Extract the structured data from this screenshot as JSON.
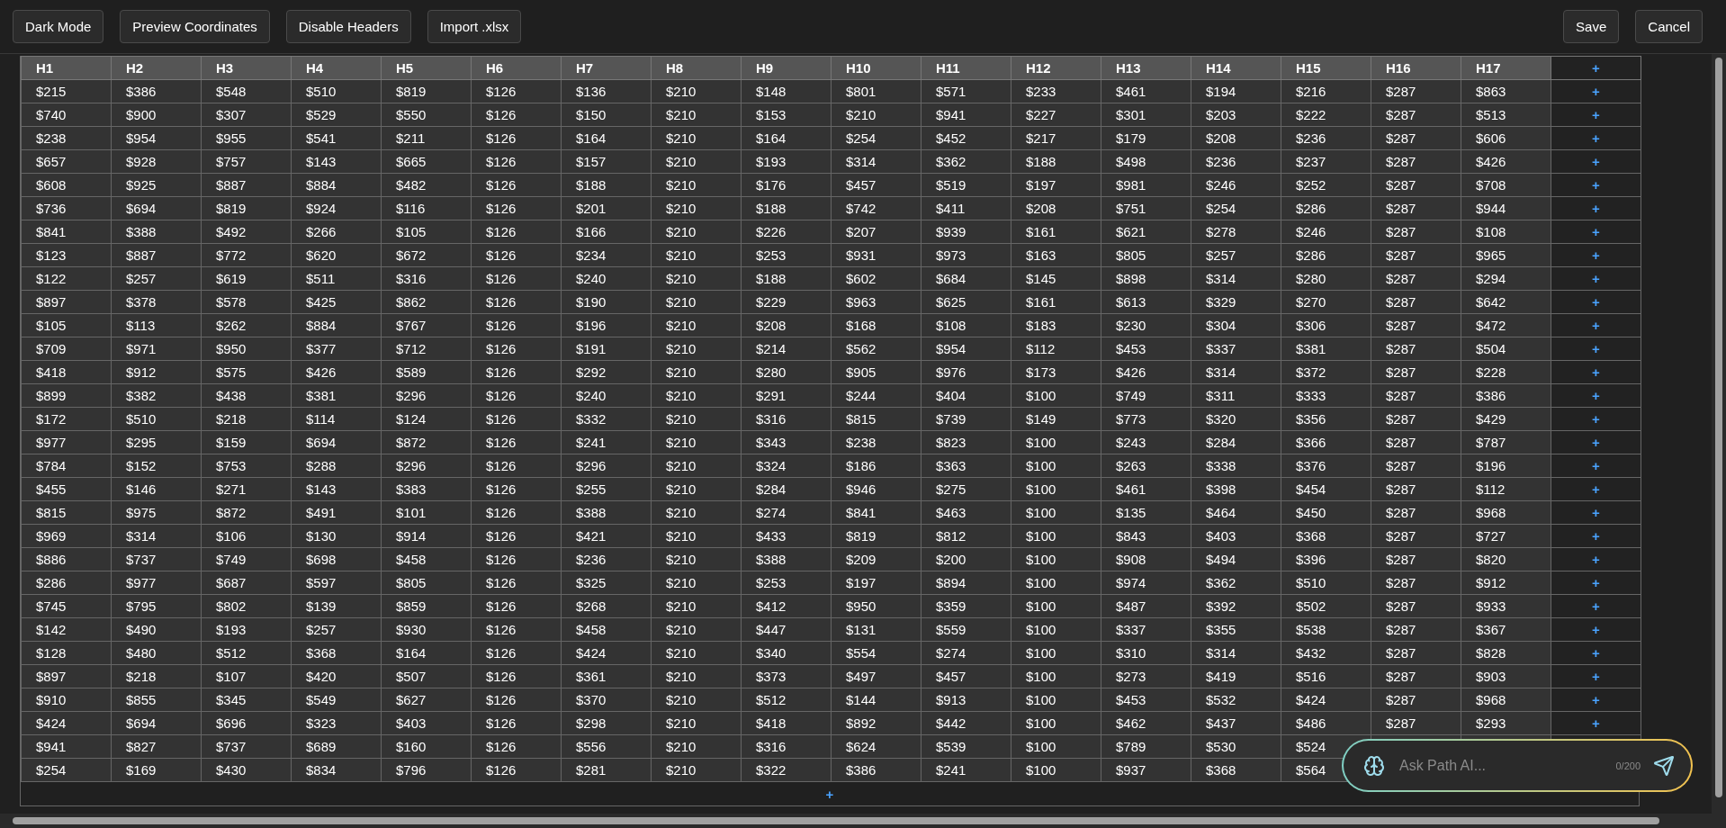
{
  "toolbar": {
    "left_buttons": [
      "Dark Mode",
      "Preview Coordinates",
      "Disable Headers",
      "Import .xlsx"
    ],
    "right_buttons": [
      "Save",
      "Cancel"
    ]
  },
  "table": {
    "columns": [
      "H1",
      "H2",
      "H3",
      "H4",
      "H5",
      "H6",
      "H7",
      "H8",
      "H9",
      "H10",
      "H11",
      "H12",
      "H13",
      "H14",
      "H15",
      "H16",
      "H17"
    ],
    "add_column": "+",
    "rows": [
      {
        "cells": [
          "$215",
          "$386",
          "$548",
          "$510",
          "$819",
          "$126",
          "$136",
          "$210",
          "$148",
          "$801",
          "$571",
          "$233",
          "$461",
          "$194",
          "$216",
          "$287",
          "$863"
        ],
        "add": "+"
      },
      {
        "cells": [
          "$740",
          "$900",
          "$307",
          "$529",
          "$550",
          "$126",
          "$150",
          "$210",
          "$153",
          "$210",
          "$941",
          "$227",
          "$301",
          "$203",
          "$222",
          "$287",
          "$513"
        ],
        "add": "+"
      },
      {
        "cells": [
          "$238",
          "$954",
          "$955",
          "$541",
          "$211",
          "$126",
          "$164",
          "$210",
          "$164",
          "$254",
          "$452",
          "$217",
          "$179",
          "$208",
          "$236",
          "$287",
          "$606"
        ],
        "add": "+"
      },
      {
        "cells": [
          "$657",
          "$928",
          "$757",
          "$143",
          "$665",
          "$126",
          "$157",
          "$210",
          "$193",
          "$314",
          "$362",
          "$188",
          "$498",
          "$236",
          "$237",
          "$287",
          "$426"
        ],
        "add": "+"
      },
      {
        "cells": [
          "$608",
          "$925",
          "$887",
          "$884",
          "$482",
          "$126",
          "$188",
          "$210",
          "$176",
          "$457",
          "$519",
          "$197",
          "$981",
          "$246",
          "$252",
          "$287",
          "$708"
        ],
        "add": "+"
      },
      {
        "cells": [
          "$736",
          "$694",
          "$819",
          "$924",
          "$116",
          "$126",
          "$201",
          "$210",
          "$188",
          "$742",
          "$411",
          "$208",
          "$751",
          "$254",
          "$286",
          "$287",
          "$944"
        ],
        "add": "+"
      },
      {
        "cells": [
          "$841",
          "$388",
          "$492",
          "$266",
          "$105",
          "$126",
          "$166",
          "$210",
          "$226",
          "$207",
          "$939",
          "$161",
          "$621",
          "$278",
          "$246",
          "$287",
          "$108"
        ],
        "add": "+"
      },
      {
        "cells": [
          "$123",
          "$887",
          "$772",
          "$620",
          "$672",
          "$126",
          "$234",
          "$210",
          "$253",
          "$931",
          "$973",
          "$163",
          "$805",
          "$257",
          "$286",
          "$287",
          "$965"
        ],
        "add": "+"
      },
      {
        "cells": [
          "$122",
          "$257",
          "$619",
          "$511",
          "$316",
          "$126",
          "$240",
          "$210",
          "$188",
          "$602",
          "$684",
          "$145",
          "$898",
          "$314",
          "$280",
          "$287",
          "$294"
        ],
        "add": "+"
      },
      {
        "cells": [
          "$897",
          "$378",
          "$578",
          "$425",
          "$862",
          "$126",
          "$190",
          "$210",
          "$229",
          "$963",
          "$625",
          "$161",
          "$613",
          "$329",
          "$270",
          "$287",
          "$642"
        ],
        "add": "+"
      },
      {
        "cells": [
          "$105",
          "$113",
          "$262",
          "$884",
          "$767",
          "$126",
          "$196",
          "$210",
          "$208",
          "$168",
          "$108",
          "$183",
          "$230",
          "$304",
          "$306",
          "$287",
          "$472"
        ],
        "add": "+"
      },
      {
        "cells": [
          "$709",
          "$971",
          "$950",
          "$377",
          "$712",
          "$126",
          "$191",
          "$210",
          "$214",
          "$562",
          "$954",
          "$112",
          "$453",
          "$337",
          "$381",
          "$287",
          "$504"
        ],
        "add": "+"
      },
      {
        "cells": [
          "$418",
          "$912",
          "$575",
          "$426",
          "$589",
          "$126",
          "$292",
          "$210",
          "$280",
          "$905",
          "$976",
          "$173",
          "$426",
          "$314",
          "$372",
          "$287",
          "$228"
        ],
        "add": "+"
      },
      {
        "cells": [
          "$899",
          "$382",
          "$438",
          "$381",
          "$296",
          "$126",
          "$240",
          "$210",
          "$291",
          "$244",
          "$404",
          "$100",
          "$749",
          "$311",
          "$333",
          "$287",
          "$386"
        ],
        "add": "+"
      },
      {
        "cells": [
          "$172",
          "$510",
          "$218",
          "$114",
          "$124",
          "$126",
          "$332",
          "$210",
          "$316",
          "$815",
          "$739",
          "$149",
          "$773",
          "$320",
          "$356",
          "$287",
          "$429"
        ],
        "add": "+"
      },
      {
        "cells": [
          "$977",
          "$295",
          "$159",
          "$694",
          "$872",
          "$126",
          "$241",
          "$210",
          "$343",
          "$238",
          "$823",
          "$100",
          "$243",
          "$284",
          "$366",
          "$287",
          "$787"
        ],
        "add": "+"
      },
      {
        "cells": [
          "$784",
          "$152",
          "$753",
          "$288",
          "$296",
          "$126",
          "$296",
          "$210",
          "$324",
          "$186",
          "$363",
          "$100",
          "$263",
          "$338",
          "$376",
          "$287",
          "$196"
        ],
        "add": "+"
      },
      {
        "cells": [
          "$455",
          "$146",
          "$271",
          "$143",
          "$383",
          "$126",
          "$255",
          "$210",
          "$284",
          "$946",
          "$275",
          "$100",
          "$461",
          "$398",
          "$454",
          "$287",
          "$112"
        ],
        "add": "+"
      },
      {
        "cells": [
          "$815",
          "$975",
          "$872",
          "$491",
          "$101",
          "$126",
          "$388",
          "$210",
          "$274",
          "$841",
          "$463",
          "$100",
          "$135",
          "$464",
          "$450",
          "$287",
          "$968"
        ],
        "add": "+"
      },
      {
        "cells": [
          "$969",
          "$314",
          "$106",
          "$130",
          "$914",
          "$126",
          "$421",
          "$210",
          "$433",
          "$819",
          "$812",
          "$100",
          "$843",
          "$403",
          "$368",
          "$287",
          "$727"
        ],
        "add": "+"
      },
      {
        "cells": [
          "$886",
          "$737",
          "$749",
          "$698",
          "$458",
          "$126",
          "$236",
          "$210",
          "$388",
          "$209",
          "$200",
          "$100",
          "$908",
          "$494",
          "$396",
          "$287",
          "$820"
        ],
        "add": "+"
      },
      {
        "cells": [
          "$286",
          "$977",
          "$687",
          "$597",
          "$805",
          "$126",
          "$325",
          "$210",
          "$253",
          "$197",
          "$894",
          "$100",
          "$974",
          "$362",
          "$510",
          "$287",
          "$912"
        ],
        "add": "+"
      },
      {
        "cells": [
          "$745",
          "$795",
          "$802",
          "$139",
          "$859",
          "$126",
          "$268",
          "$210",
          "$412",
          "$950",
          "$359",
          "$100",
          "$487",
          "$392",
          "$502",
          "$287",
          "$933"
        ],
        "add": "+"
      },
      {
        "cells": [
          "$142",
          "$490",
          "$193",
          "$257",
          "$930",
          "$126",
          "$458",
          "$210",
          "$447",
          "$131",
          "$559",
          "$100",
          "$337",
          "$355",
          "$538",
          "$287",
          "$367"
        ],
        "add": "+"
      },
      {
        "cells": [
          "$128",
          "$480",
          "$512",
          "$368",
          "$164",
          "$126",
          "$424",
          "$210",
          "$340",
          "$554",
          "$274",
          "$100",
          "$310",
          "$314",
          "$432",
          "$287",
          "$828"
        ],
        "add": "+"
      },
      {
        "cells": [
          "$897",
          "$218",
          "$107",
          "$420",
          "$507",
          "$126",
          "$361",
          "$210",
          "$373",
          "$497",
          "$457",
          "$100",
          "$273",
          "$419",
          "$516",
          "$287",
          "$903"
        ],
        "add": "+"
      },
      {
        "cells": [
          "$910",
          "$855",
          "$345",
          "$549",
          "$627",
          "$126",
          "$370",
          "$210",
          "$512",
          "$144",
          "$913",
          "$100",
          "$453",
          "$532",
          "$424",
          "$287",
          "$968"
        ],
        "add": "+"
      },
      {
        "cells": [
          "$424",
          "$694",
          "$696",
          "$323",
          "$403",
          "$126",
          "$298",
          "$210",
          "$418",
          "$892",
          "$442",
          "$100",
          "$462",
          "$437",
          "$486",
          "$287",
          "$293"
        ],
        "add": "+"
      },
      {
        "cells": [
          "$941",
          "$827",
          "$737",
          "$689",
          "$160",
          "$126",
          "$556",
          "$210",
          "$316",
          "$624",
          "$539",
          "$100",
          "$789",
          "$530",
          "$524"
        ]
      },
      {
        "cells": [
          "$254",
          "$169",
          "$430",
          "$834",
          "$796",
          "$126",
          "$281",
          "$210",
          "$322",
          "$386",
          "$241",
          "$100",
          "$937",
          "$368",
          "$564"
        ]
      }
    ],
    "add_row": "+"
  },
  "ai_chat": {
    "placeholder": "Ask Path AI...",
    "counter": "0/200"
  }
}
